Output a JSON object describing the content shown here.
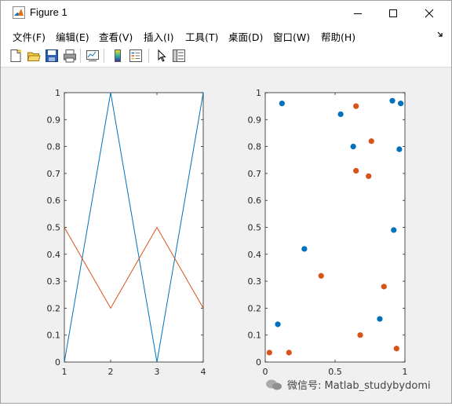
{
  "window": {
    "title": "Figure 1"
  },
  "menu": [
    "文件(F)",
    "编辑(E)",
    "查看(V)",
    "插入(I)",
    "工具(T)",
    "桌面(D)",
    "窗口(W)",
    "帮助(H)"
  ],
  "toolbar": [
    "new-figure-icon",
    "open-file-icon",
    "save-icon",
    "print-icon",
    "link-plot-icon",
    "insert-colorbar-icon",
    "insert-legend-icon",
    "edit-plot-icon",
    "property-inspector-icon"
  ],
  "colors": {
    "series1": "#0072bd",
    "series2": "#d95319"
  },
  "watermark": "微信号: Matlab_studybydomi",
  "chart_data": [
    {
      "type": "line",
      "x": [
        1,
        2,
        3,
        4
      ],
      "series": [
        {
          "values": [
            0,
            1,
            0,
            1
          ]
        },
        {
          "values": [
            0.5,
            0.2,
            0.5,
            0.2
          ]
        }
      ],
      "xlim": [
        1,
        4
      ],
      "ylim": [
        0,
        1
      ],
      "xticks": [
        "1",
        "2",
        "3",
        "4"
      ],
      "yticks": [
        "0",
        "0.1",
        "0.2",
        "0.3",
        "0.4",
        "0.5",
        "0.6",
        "0.7",
        "0.8",
        "0.9",
        "1"
      ],
      "grid": false
    },
    {
      "type": "scatter",
      "series": [
        {
          "points": [
            [
              0.12,
              0.96
            ],
            [
              0.54,
              0.92
            ],
            [
              0.91,
              0.97
            ],
            [
              0.97,
              0.96
            ],
            [
              0.63,
              0.8
            ],
            [
              0.96,
              0.79
            ],
            [
              0.92,
              0.49
            ],
            [
              0.28,
              0.42
            ],
            [
              0.09,
              0.14
            ],
            [
              0.82,
              0.16
            ]
          ]
        },
        {
          "points": [
            [
              0.65,
              0.95
            ],
            [
              0.76,
              0.82
            ],
            [
              0.65,
              0.71
            ],
            [
              0.74,
              0.69
            ],
            [
              0.4,
              0.32
            ],
            [
              0.85,
              0.28
            ],
            [
              0.68,
              0.1
            ],
            [
              0.94,
              0.05
            ],
            [
              0.17,
              0.035
            ],
            [
              0.03,
              0.035
            ]
          ]
        }
      ],
      "xlim": [
        0,
        1
      ],
      "ylim": [
        0,
        1
      ],
      "xticks": [
        "0",
        "0.5",
        "1"
      ],
      "yticks": [
        "0",
        "0.1",
        "0.2",
        "0.3",
        "0.4",
        "0.5",
        "0.6",
        "0.7",
        "0.8",
        "0.9",
        "1"
      ],
      "grid": false
    }
  ]
}
